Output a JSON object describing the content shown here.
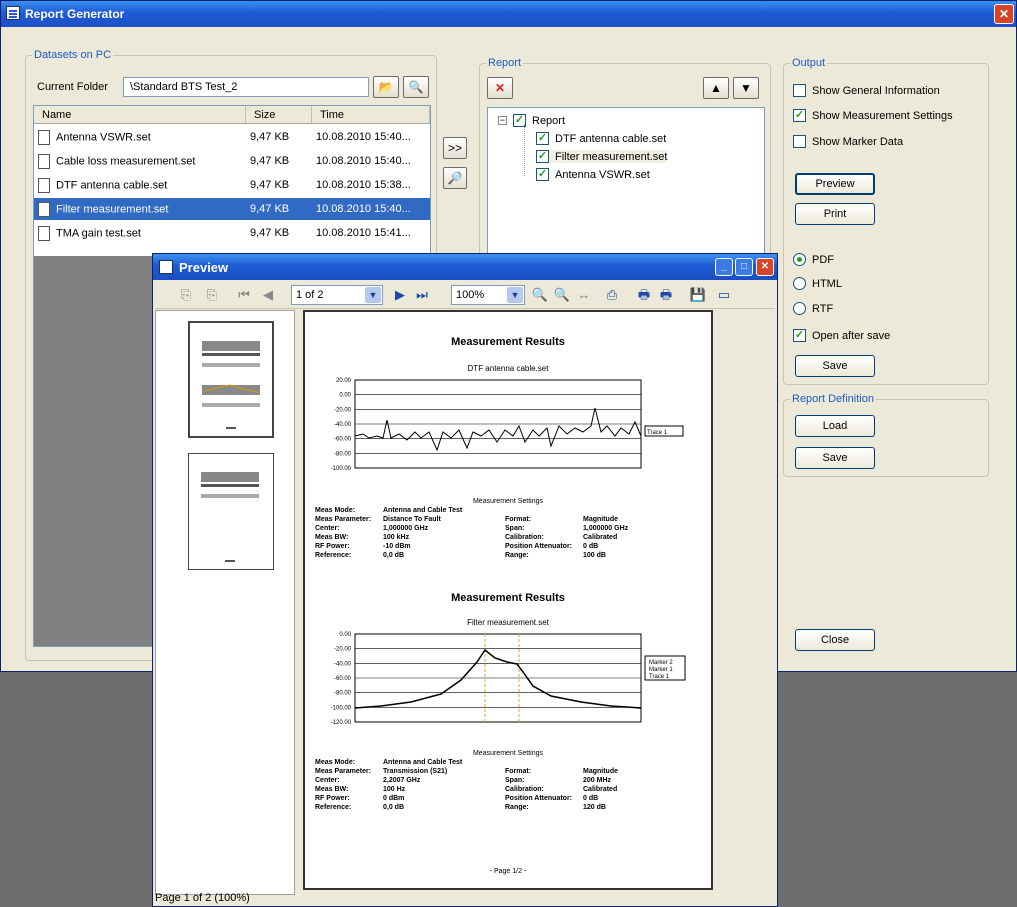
{
  "window": {
    "title": "Report Generator"
  },
  "datasets": {
    "group_title": "Datasets on PC",
    "folder_label": "Current Folder",
    "folder_value": "\\Standard BTS Test_2",
    "columns": [
      "Name",
      "Size",
      "Time"
    ],
    "rows": [
      {
        "name": "Antenna VSWR.set",
        "size": "9,47 KB",
        "time": "10.08.2010 15:40..."
      },
      {
        "name": "Cable loss measurement.set",
        "size": "9,47 KB",
        "time": "10.08.2010 15:40..."
      },
      {
        "name": "DTF antenna cable.set",
        "size": "9,47 KB",
        "time": "10.08.2010 15:38..."
      },
      {
        "name": "Filter measurement.set",
        "size": "9,47 KB",
        "time": "10.08.2010 15:40..."
      },
      {
        "name": "TMA gain test.set",
        "size": "9,47 KB",
        "time": "10.08.2010 15:41..."
      }
    ]
  },
  "report": {
    "group_title": "Report",
    "add_label": ">>",
    "tree_root": "Report",
    "tree_items": [
      "DTF antenna cable.set",
      "Filter measurement.set",
      "Antenna VSWR.set"
    ]
  },
  "output": {
    "group_title": "Output",
    "opt_general": "Show General Information",
    "opt_settings": "Show Measurement Settings",
    "opt_marker": "Show Marker Data",
    "preview_label": "Preview",
    "print_label": "Print",
    "pdf_label": "PDF",
    "html_label": "HTML",
    "rtf_label": "RTF",
    "open_after_label": "Open after save",
    "save_label": "Save"
  },
  "report_definition": {
    "group_title": "Report Definition",
    "load_label": "Load",
    "save_label": "Save"
  },
  "close_label": "Close",
  "preview": {
    "title": "Preview",
    "page_combo": "1 of 2",
    "zoom_combo": "100%",
    "status": "Page 1 of 2 (100%)",
    "page_title_1": "Measurement Results",
    "chart1_title": "DTF antenna cable.set",
    "chart1_yticks": [
      "20.00",
      "0.00",
      "-20.00",
      "-40.00",
      "-60.00",
      "-80.00",
      "-100.00"
    ],
    "chart1_legend": "Trace 1",
    "settings_title": "Measurement Settings",
    "page_title_2": "Measurement Results",
    "chart2_title": "Filter measurement.set",
    "chart2_yticks": [
      "0.00",
      "-20.00",
      "-40.00",
      "-60.00",
      "-80.00",
      "-100.00",
      "-120.00"
    ],
    "chart2_legend": [
      "Marker 2",
      "Marker 1",
      "Trace 1"
    ],
    "page_footer": "- Page 1/2 -",
    "settings1": [
      [
        "Meas Mode:",
        "Antenna and Cable Test",
        "",
        ""
      ],
      [
        "Meas Parameter:",
        "Distance To Fault",
        "Format:",
        "Magnitude"
      ],
      [
        "Center:",
        "1,000000 GHz",
        "Span:",
        "1,000000 GHz"
      ],
      [
        "Meas BW:",
        "100 kHz",
        "Calibration:",
        "Calibrated"
      ],
      [
        "RF Power:",
        "-10 dBm",
        "Position Attenuator:",
        "0 dB"
      ],
      [
        "Reference:",
        "0,0 dB",
        "Range:",
        "100 dB"
      ]
    ],
    "settings2": [
      [
        "Meas Mode:",
        "Antenna and Cable Test",
        "",
        ""
      ],
      [
        "Meas Parameter:",
        "Transmission (S21)",
        "Format:",
        "Magnitude"
      ],
      [
        "Center:",
        "2,2007 GHz",
        "Span:",
        "200 MHz"
      ],
      [
        "Meas BW:",
        "100 Hz",
        "Calibration:",
        "Calibrated"
      ],
      [
        "RF Power:",
        "0 dBm",
        "Position Attenuator:",
        "0 dB"
      ],
      [
        "Reference:",
        "0,0 dB",
        "Range:",
        "120 dB"
      ]
    ]
  },
  "colors": {
    "accent": "#316ac5",
    "titlebar": "#1f5bd6",
    "face": "#ece9d8"
  }
}
